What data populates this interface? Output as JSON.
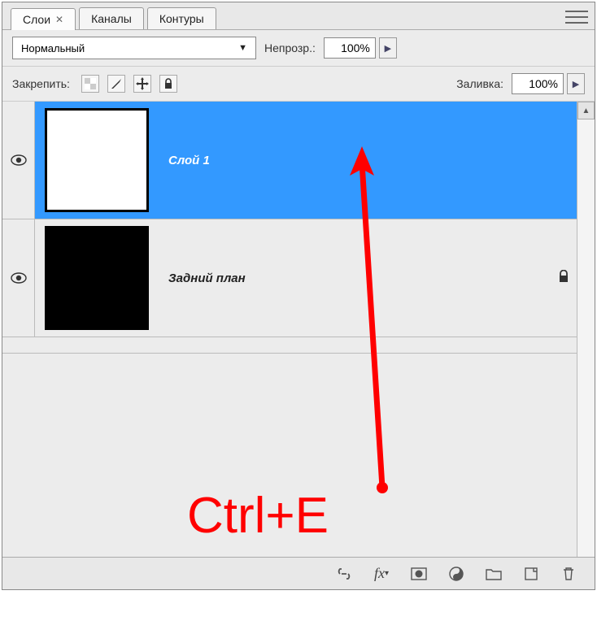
{
  "tabs": {
    "items": [
      {
        "label": "Слои",
        "active": true,
        "closeable": true
      },
      {
        "label": "Каналы",
        "active": false
      },
      {
        "label": "Контуры",
        "active": false
      }
    ]
  },
  "blend": {
    "mode": "Нормальный",
    "opacity_label": "Непрозр.:",
    "opacity_value": "100%"
  },
  "lock": {
    "label": "Закрепить:",
    "fill_label": "Заливка:",
    "fill_value": "100%"
  },
  "layers": [
    {
      "name": "Слой 1",
      "selected": true,
      "locked": false,
      "visible": true,
      "thumb": "checker"
    },
    {
      "name": "Задний план",
      "selected": false,
      "locked": true,
      "visible": true,
      "thumb": "black"
    }
  ],
  "annotation": {
    "text": "Ctrl+E"
  }
}
